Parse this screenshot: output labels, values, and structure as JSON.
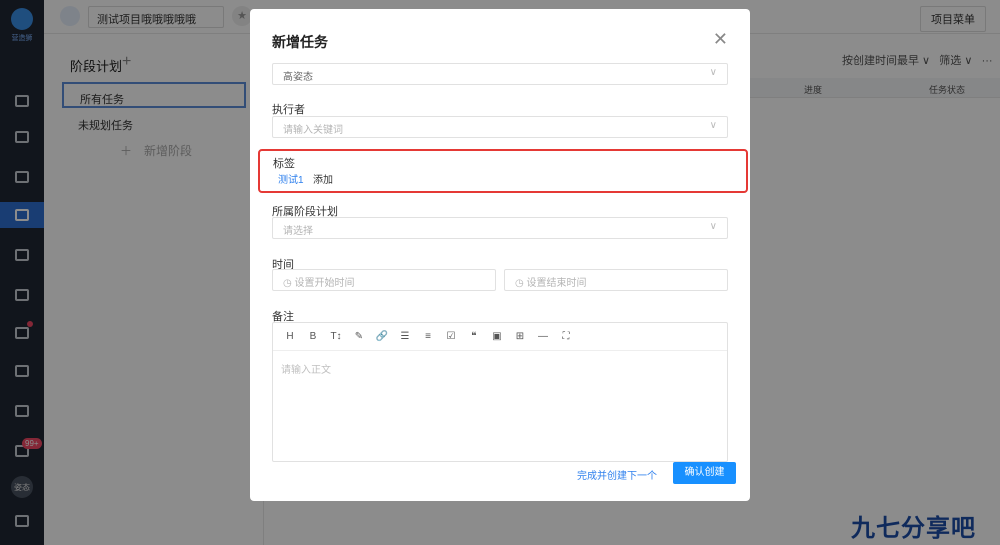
{
  "nav": {
    "logo_text": "营造狮",
    "badge": "99+",
    "avatar": "姿态"
  },
  "topbar": {
    "project_name": "测试项目哦哦哦哦哦",
    "star": "★",
    "menu": "项目菜单"
  },
  "stages": {
    "title": "阶段计划",
    "plus": "+",
    "items": [
      "所有任务",
      "未规划任务"
    ],
    "add": "＋　新增阶段"
  },
  "sort": {
    "order": "按创建时间最早 ∨",
    "filter": "筛选 ∨",
    "more": "···"
  },
  "table": {
    "progress": "进度",
    "status": "任务状态"
  },
  "modal": {
    "title": "新增任务",
    "close": "✕",
    "priority_value": "高姿态",
    "executor_label": "执行者",
    "executor_placeholder": "请输入关键词",
    "tag_label": "标签",
    "tags": [
      "测试1"
    ],
    "tag_add": "添加",
    "stage_label": "所属阶段计划",
    "stage_placeholder": "请选择",
    "time_label": "时间",
    "start_placeholder": "◷ 设置开始时间",
    "end_placeholder": "◷ 设置结束时间",
    "note_label": "备注",
    "editor_placeholder": "请输入正文",
    "toolbar": [
      "H",
      "B",
      "T↕",
      "✎",
      "🔗",
      "☰",
      "≡",
      "☑",
      "❝",
      "▣",
      "⊞",
      "—",
      "⛶"
    ],
    "next_link": "完成并创建下一个",
    "confirm": "确认创建"
  },
  "watermark": "九七分享吧"
}
